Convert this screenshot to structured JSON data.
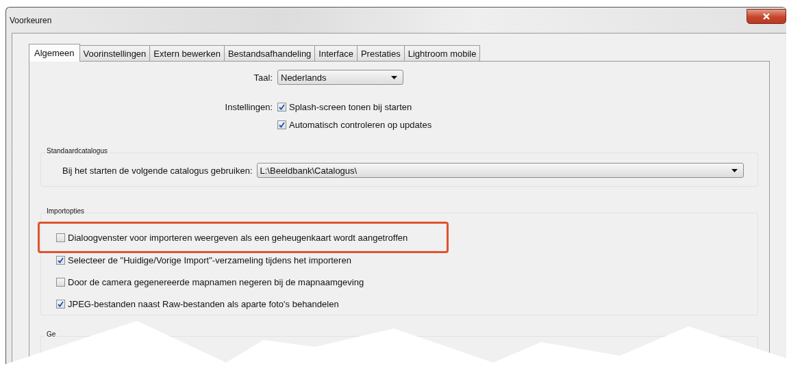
{
  "window": {
    "title": "Voorkeuren"
  },
  "tabs": [
    {
      "label": "Algemeen",
      "selected": true
    },
    {
      "label": "Voorinstellingen",
      "selected": false
    },
    {
      "label": "Extern bewerken",
      "selected": false
    },
    {
      "label": "Bestandsafhandeling",
      "selected": false
    },
    {
      "label": "Interface",
      "selected": false
    },
    {
      "label": "Prestaties",
      "selected": false
    },
    {
      "label": "Lightroom mobile",
      "selected": false
    }
  ],
  "language": {
    "label": "Taal:",
    "value": "Nederlands"
  },
  "settings": {
    "label": "Instellingen:",
    "options": [
      {
        "label": "Splash-screen tonen bij starten",
        "checked": true
      },
      {
        "label": "Automatisch controleren op updates",
        "checked": true
      }
    ]
  },
  "default_catalog": {
    "title": "Standaardcatalogus",
    "label": "Bij het starten de volgende catalogus gebruiken:",
    "value": "L:\\Beeldbank\\Catalogus\\"
  },
  "import_options": {
    "title": "Importopties",
    "options": [
      {
        "label": "Dialoogvenster voor importeren weergeven als een geheugenkaart wordt aangetroffen",
        "checked": false,
        "highlighted": true
      },
      {
        "label": "Selecteer de \"Huidige/Vorige Import\"-verzameling tijdens het importeren",
        "checked": true,
        "highlighted": false
      },
      {
        "label": "Door de camera gegenereerde mapnamen negeren bij de mapnaamgeving",
        "checked": false,
        "highlighted": false
      },
      {
        "label": "JPEG-bestanden naast Raw-bestanden als aparte foto's behandelen",
        "checked": true,
        "highlighted": false
      }
    ]
  },
  "next_group": {
    "title": "Ge"
  }
}
